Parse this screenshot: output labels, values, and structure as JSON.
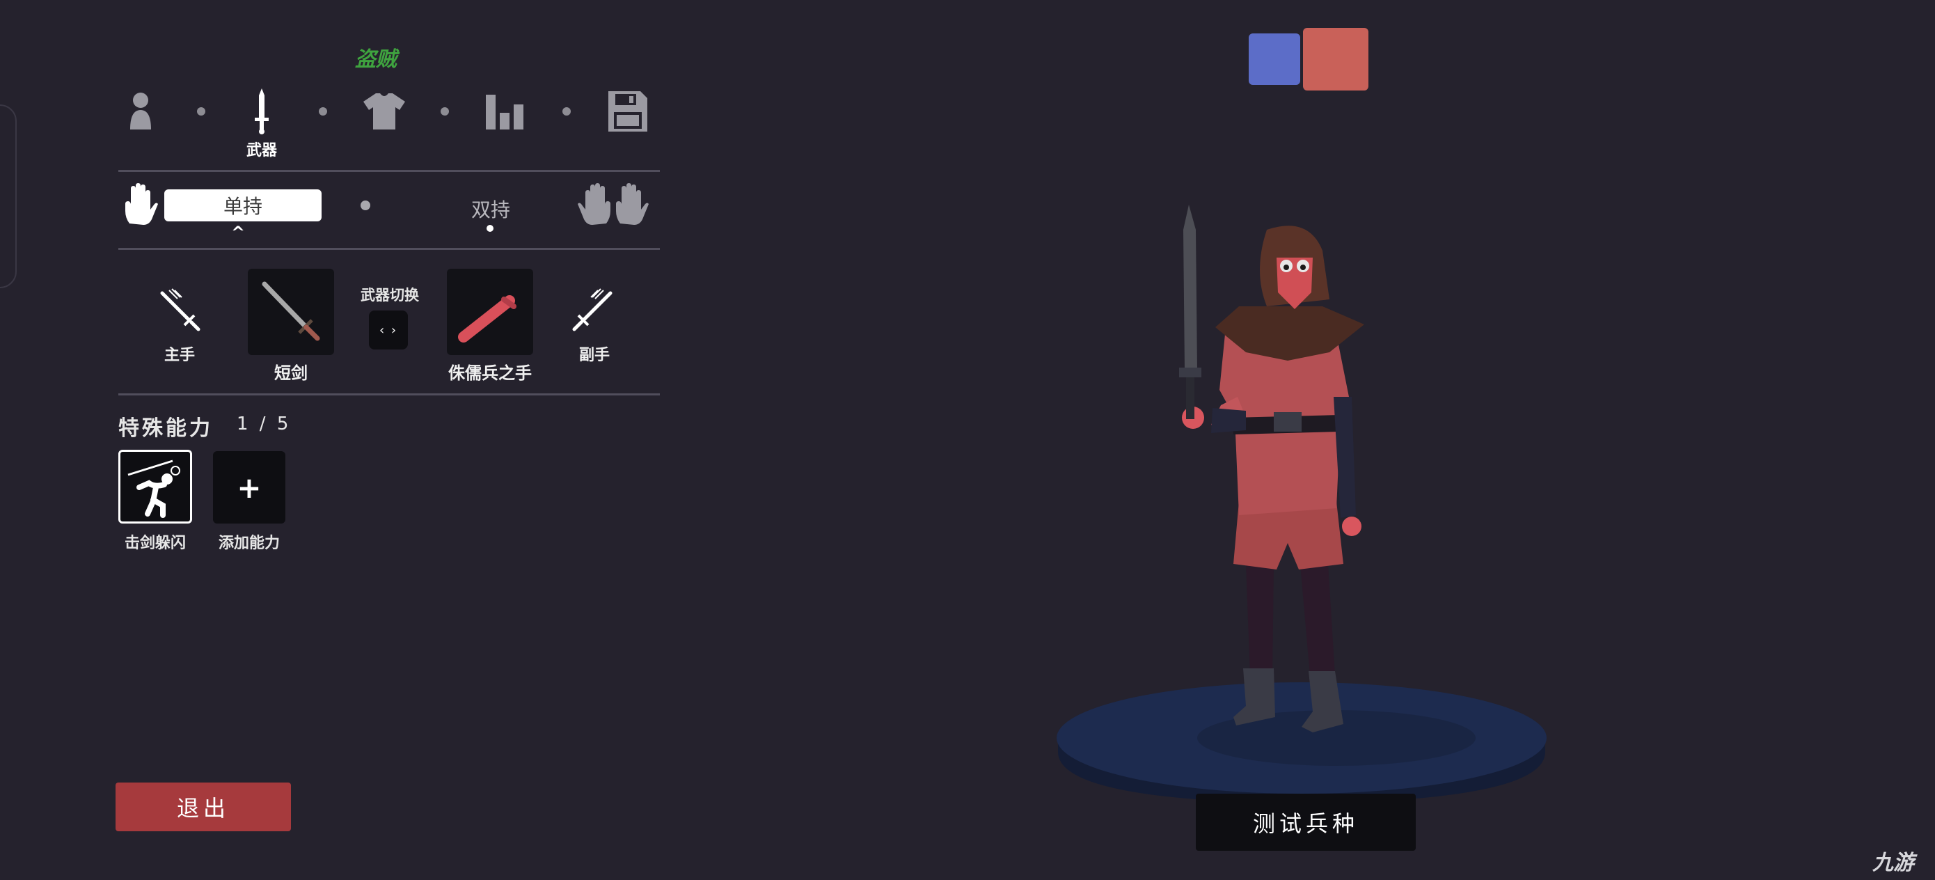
{
  "unit_name": "盗贼",
  "steps": [
    {
      "icon": "person-icon",
      "label": ""
    },
    {
      "icon": "sword-icon",
      "label": "武器",
      "active": true
    },
    {
      "icon": "shirt-icon",
      "label": ""
    },
    {
      "icon": "stats-icon",
      "label": ""
    },
    {
      "icon": "save-icon",
      "label": ""
    }
  ],
  "grip": {
    "one_hand": "单持",
    "two_hand": "双持"
  },
  "weapons": {
    "main_hand_label": "主手",
    "main_weapon": "短剑",
    "switch_label": "武器切换",
    "switch_button": "‹ ›",
    "off_weapon": "侏儒兵之手",
    "off_hand_label": "副手"
  },
  "abilities": {
    "title": "特殊能力",
    "count": "1 / 5",
    "items": [
      {
        "label": "击剑躲闪",
        "icon": "fencing-dodge-icon"
      },
      {
        "label": "添加能力",
        "icon": "plus-icon"
      }
    ]
  },
  "exit_label": "退出",
  "test_label": "测试兵种",
  "team_colors": {
    "blue": "#5c6dc8",
    "red": "#c96159"
  },
  "watermark": "九游"
}
